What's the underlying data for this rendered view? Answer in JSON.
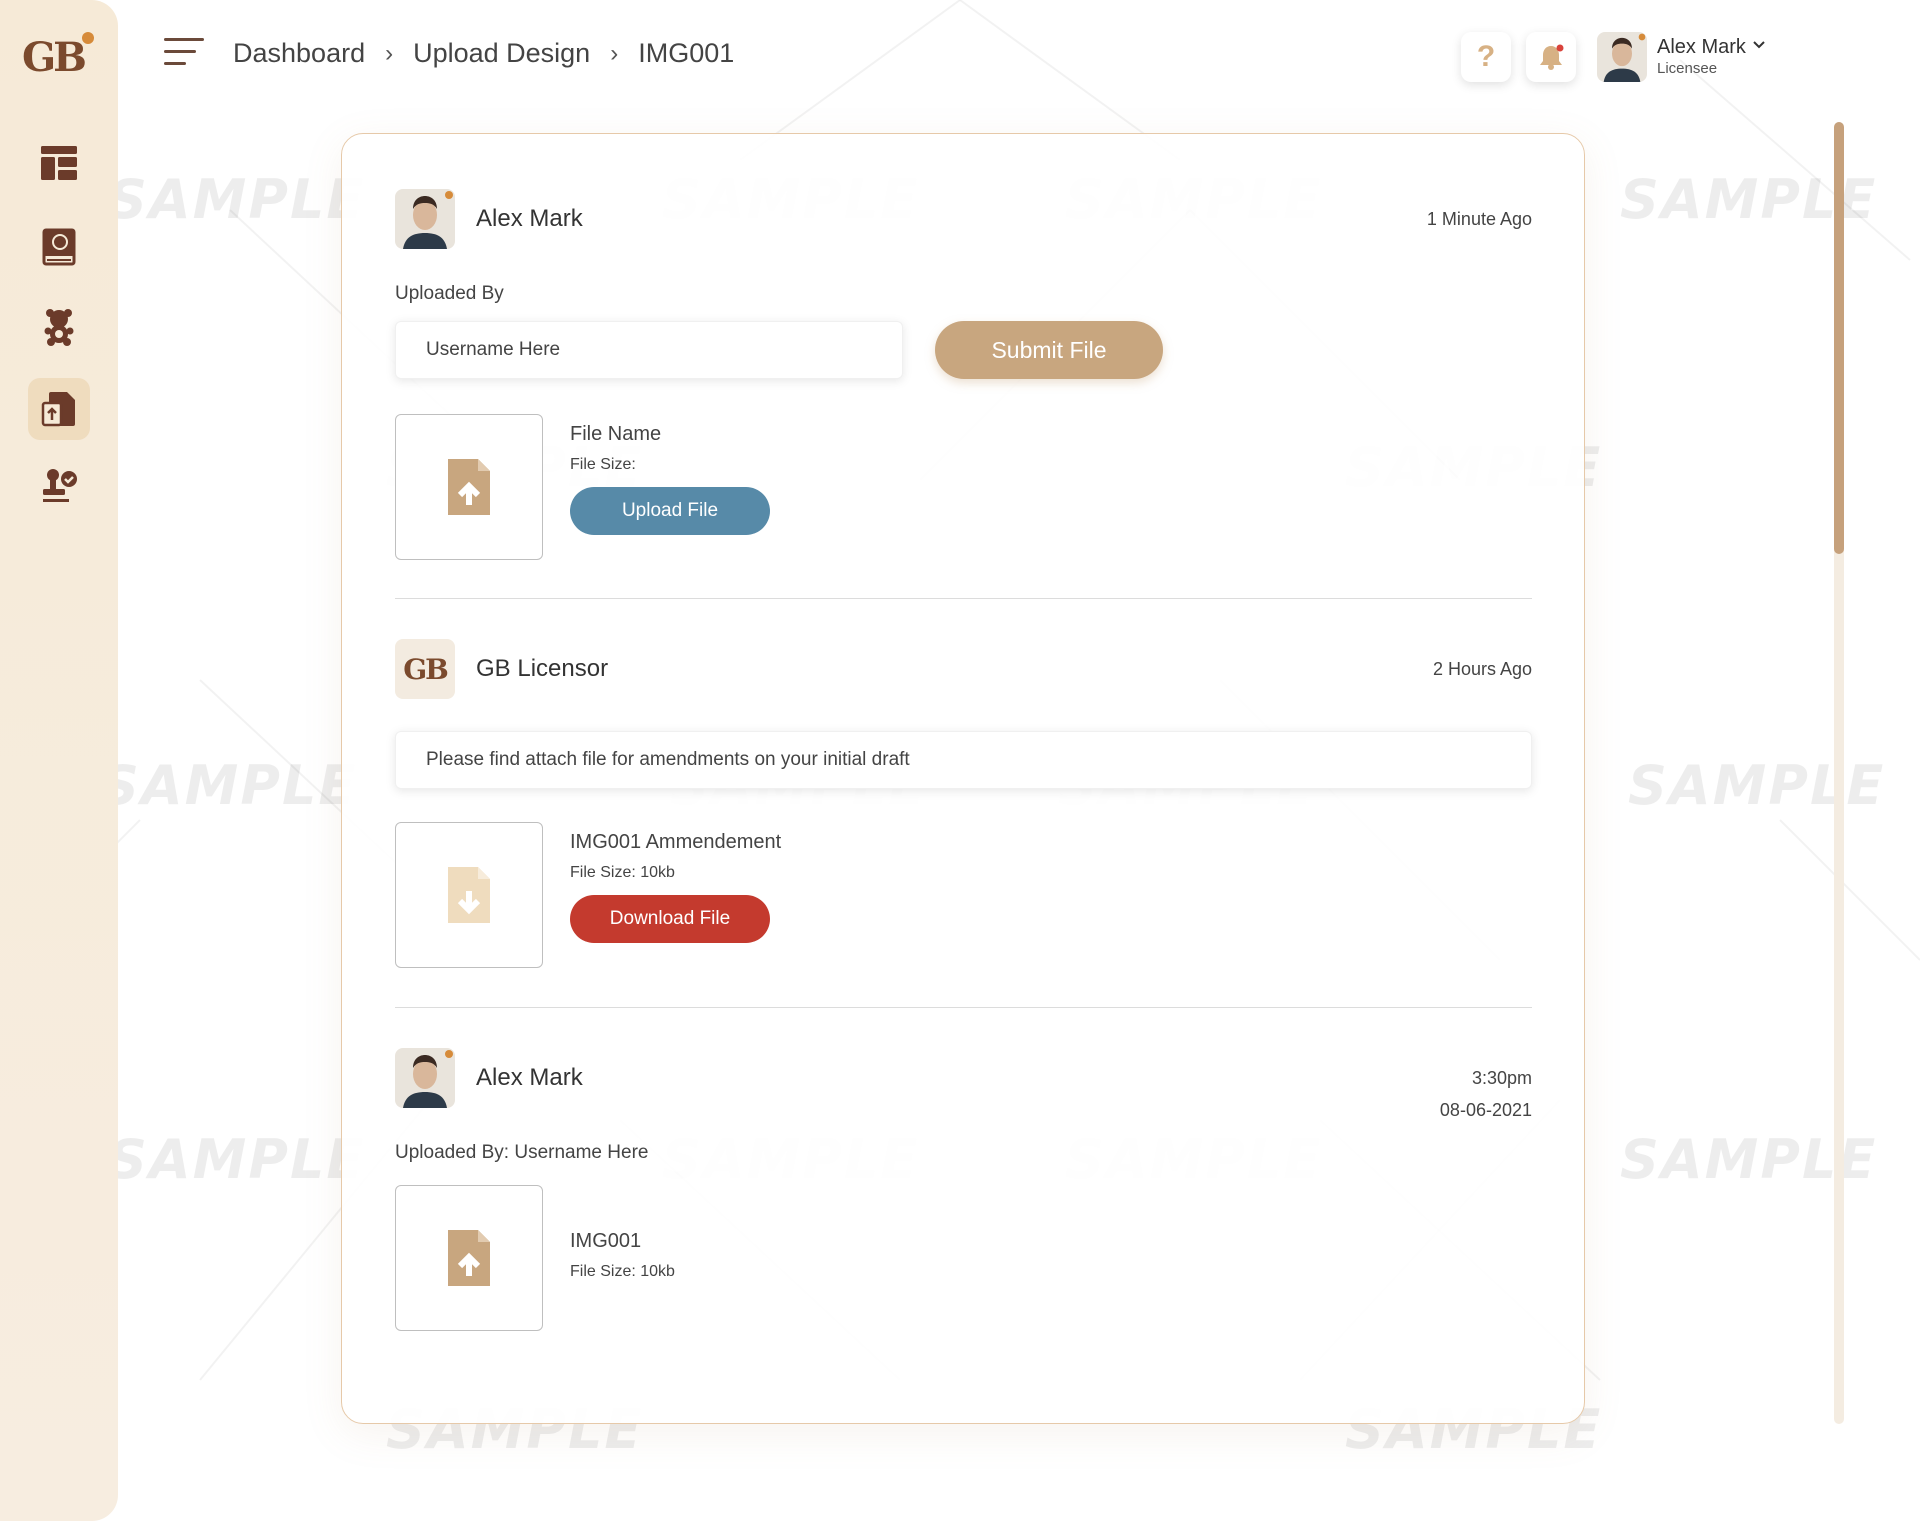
{
  "brand": {
    "logo_text": "GB"
  },
  "sidebar": {
    "items": [
      {
        "name": "dashboard",
        "icon": "dashboard-layout-icon",
        "active": false
      },
      {
        "name": "catalog",
        "icon": "book-icon",
        "active": false
      },
      {
        "name": "characters",
        "icon": "teddy-bear-icon",
        "active": false
      },
      {
        "name": "upload-design",
        "icon": "file-upload-icon",
        "active": true
      },
      {
        "name": "approvals",
        "icon": "stamp-check-icon",
        "active": false
      }
    ]
  },
  "header": {
    "breadcrumb": [
      "Dashboard",
      "Upload Design",
      "IMG001"
    ],
    "help_label": "?",
    "user": {
      "name": "Alex Mark",
      "role": "Licensee"
    }
  },
  "entries": {
    "first": {
      "author": "Alex Mark",
      "time": "1 Minute Ago",
      "uploaded_by_label": "Uploaded By",
      "username_value": "Username Here",
      "submit_label": "Submit File",
      "file_name": "File Name",
      "file_size": "File Size:",
      "upload_label": "Upload File"
    },
    "second": {
      "author": "GB Licensor",
      "author_logo": "GB",
      "time": "2 Hours Ago",
      "message": "Please find attach file for amendments on your initial draft",
      "file_name": "IMG001 Ammendement",
      "file_size": "File Size: 10kb",
      "download_label": "Download File"
    },
    "third": {
      "author": "Alex Mark",
      "time": "3:30pm",
      "date": "08-06-2021",
      "uploaded_by": "Uploaded By: Username Here",
      "file_name": "IMG001",
      "file_size": "File Size: 10kb"
    }
  },
  "watermark": "SAMPLE",
  "colors": {
    "accent": "#c8a67f",
    "upload_blue": "#578aa8",
    "download_red": "#c43a2e",
    "brown": "#7b4a2d",
    "sidebar_bg": "#f6ead7"
  }
}
